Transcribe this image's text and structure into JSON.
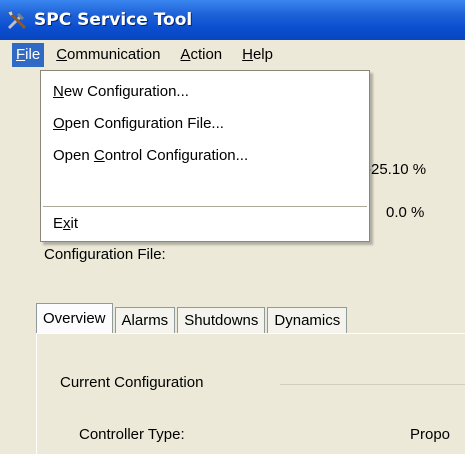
{
  "window": {
    "title": "SPC Service Tool",
    "icon": "tools-icon"
  },
  "menubar": {
    "items": [
      {
        "label": "File",
        "underline": "F",
        "rest": "ile",
        "active": true
      },
      {
        "label": "Communication",
        "underline": "C",
        "rest": "ommunication"
      },
      {
        "label": "Action",
        "underline": "A",
        "rest": "ction"
      },
      {
        "label": "Help",
        "underline": "H",
        "rest": "elp"
      }
    ]
  },
  "file_menu": {
    "new_config": {
      "underline": "N",
      "rest": "ew Configuration..."
    },
    "open_config_file": {
      "underline": "O",
      "rest": "pen Configuration File..."
    },
    "open_control_config": {
      "pre": "Open ",
      "underline": "C",
      "rest": "ontrol Configuration..."
    },
    "exit": {
      "pre": "E",
      "underline": "x",
      "rest": "it"
    }
  },
  "status": {
    "value1": "-25.10 %",
    "value2": "0.0 %",
    "config_file_label": "Configuration File:"
  },
  "tabs": [
    "Overview",
    "Alarms",
    "Shutdowns",
    "Dynamics"
  ],
  "overview": {
    "group_label": "Current Configuration",
    "controller_type_label": "Controller Type:",
    "controller_type_value": "Propo"
  },
  "colors": {
    "titlebar": "#0a4ed0",
    "menu_highlight": "#316ac5",
    "background": "#ece9d8"
  }
}
